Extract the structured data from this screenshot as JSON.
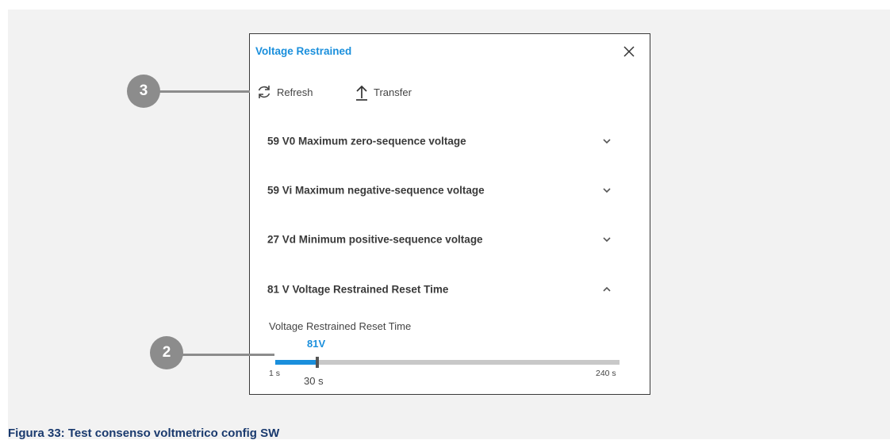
{
  "dialog": {
    "title": "Voltage Restrained",
    "close_icon": "close-icon",
    "toolbar": {
      "refresh_label": "Refresh",
      "transfer_label": "Transfer"
    },
    "sections": [
      {
        "label": "59 V0 Maximum zero-sequence voltage",
        "expanded": false
      },
      {
        "label": "59 Vi Maximum negative-sequence voltage",
        "expanded": false
      },
      {
        "label": "27 Vd Minimum positive-sequence voltage",
        "expanded": false
      },
      {
        "label": "81 V Voltage Restrained Reset Time",
        "expanded": true
      }
    ],
    "parameter": {
      "label": "Voltage Restrained Reset Time",
      "device": "81V",
      "min_label": "1 s",
      "max_label": "240 s",
      "value_label": "30 s",
      "min": 1,
      "max": 240,
      "value": 30
    }
  },
  "callouts": [
    "3",
    "2"
  ],
  "caption": "Figura 33: Test consenso voltmetrico config SW",
  "colors": {
    "accent": "#1a8fdc",
    "callout": "#8c8c8c",
    "caption": "#1a3a6e",
    "text": "#3a3a3a",
    "figure_background": "#f2f2f2"
  }
}
